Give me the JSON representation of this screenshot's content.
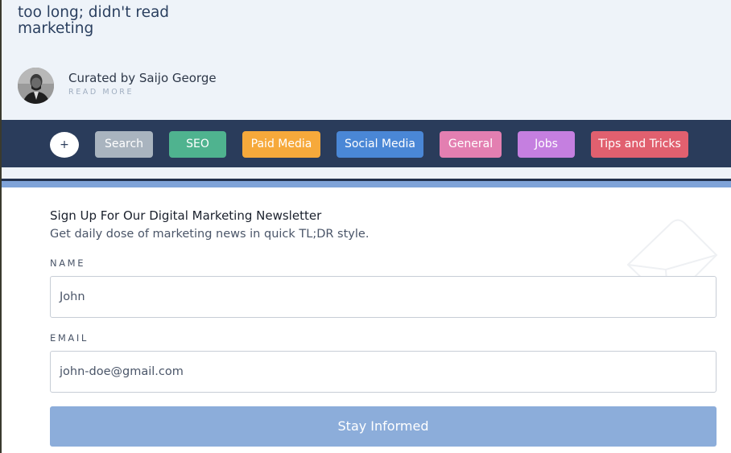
{
  "header": {
    "title_line1": "too long; didn't read",
    "title_line2": "marketing",
    "curator": "Curated by Saijo George",
    "read_more": "READ MORE"
  },
  "nav": {
    "plus_label": "+",
    "items": [
      {
        "label": "Search",
        "color": "#a9b4bf"
      },
      {
        "label": "SEO",
        "color": "#4fb38f"
      },
      {
        "label": "Paid Media",
        "color": "#f6a93b"
      },
      {
        "label": "Social Media",
        "color": "#4a87d6"
      },
      {
        "label": "General",
        "color": "#e37fb1"
      },
      {
        "label": "Jobs",
        "color": "#c57fe0"
      },
      {
        "label": "Tips and Tricks",
        "color": "#e1606f"
      }
    ]
  },
  "signup": {
    "title": "Sign Up For Our Digital Marketing Newsletter",
    "subtitle": "Get daily dose of marketing news in quick TL;DR style.",
    "name_label": "NAME",
    "name_value": "John",
    "email_label": "EMAIL",
    "email_value": "john-doe@gmail.com",
    "submit_label": "Stay Informed",
    "submit_color": "#8cadda"
  },
  "icons": {
    "avatar": "curator-avatar",
    "decoration": "envelope-icon"
  }
}
